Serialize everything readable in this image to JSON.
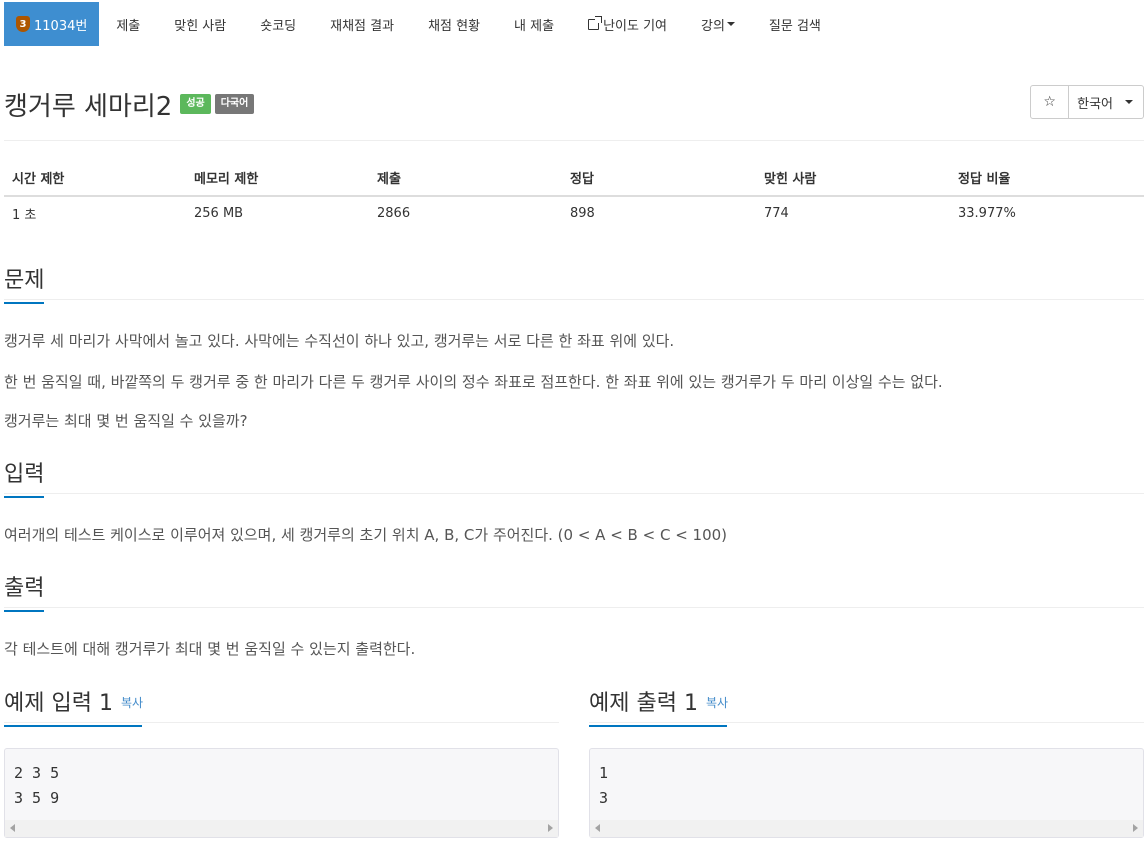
{
  "nav": {
    "problem_tier_number": "3",
    "problem_label": "11034번",
    "items": [
      "제출",
      "맞힌 사람",
      "숏코딩",
      "재채점 결과",
      "채점 현황",
      "내 제출"
    ],
    "difficulty_label": "난이도 기여",
    "lecture_label": "강의",
    "question_search_label": "질문 검색"
  },
  "problem": {
    "title": "캥거루 세마리2",
    "badge_success": "성공",
    "badge_multilang": "다국어",
    "star_glyph": "☆",
    "language": "한국어"
  },
  "stats": {
    "headers": [
      "시간 제한",
      "메모리 제한",
      "제출",
      "정답",
      "맞힌 사람",
      "정답 비율"
    ],
    "values": [
      "1 초",
      "256 MB",
      "2866",
      "898",
      "774",
      "33.977%"
    ]
  },
  "sections": {
    "description_heading": "문제",
    "description": [
      "캥거루 세 마리가 사막에서 놀고 있다. 사막에는 수직선이 하나 있고, 캥거루는 서로 다른 한 좌표 위에 있다.",
      "한 번 움직일 때, 바깥쪽의 두 캥거루 중 한 마리가 다른 두 캥거루 사이의 정수 좌표로 점프한다. 한 좌표 위에 있는 캥거루가 두 마리 이상일 수는 없다.",
      "캥거루는 최대 몇 번 움직일 수 있을까?"
    ],
    "input_heading": "입력",
    "input": "여러개의 테스트 케이스로 이루어져 있으며, 세 캥거루의 초기 위치 A, B, C가 주어진다. (0 < A < B < C < 100)",
    "output_heading": "출력",
    "output": "각 테스트에 대해 캥거루가 최대 몇 번 움직일 수 있는지 출력한다."
  },
  "samples": {
    "input_heading": "예제 입력 1",
    "output_heading": "예제 출력 1",
    "copy_label": "복사",
    "input_text": "2 3 5\n3 5 9",
    "output_text": "1\n3"
  }
}
